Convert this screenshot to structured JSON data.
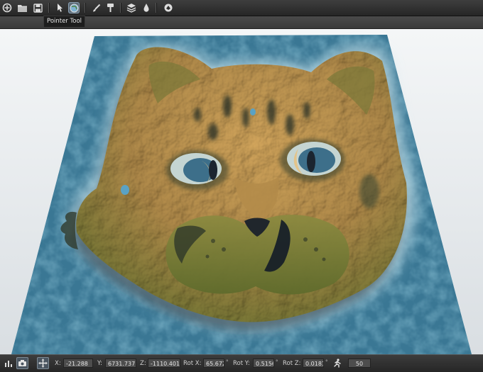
{
  "toolbar": {
    "tooltip": "Pointer Tool",
    "icons": [
      "new-scene-icon",
      "open-folder-icon",
      "save-icon",
      "pointer-tool-icon",
      "globe-icon",
      "paint-brush-icon",
      "flatten-tool-icon",
      "layers-icon",
      "water-drop-icon",
      "render-icon"
    ]
  },
  "statusbar": {
    "x_label": "X:",
    "x_value": "-21.288",
    "y_label": "Y:",
    "y_value": "6731.737",
    "z_label": "Z:",
    "z_value": "-1110.401",
    "rotx_label": "Rot X:",
    "rotx_value": "65.672",
    "roty_label": "Rot Y:",
    "roty_value": "0.5156",
    "rotz_label": "Rot Z:",
    "rotz_value": "0.0181",
    "degree_symbol": "°",
    "speed_value": "50"
  },
  "colors": {
    "toolbar_bg": "#2e2e2e",
    "water": "#3d7a96",
    "terrain_sand": "#c89a52",
    "terrain_green": "#6f7a32",
    "shadow": "#1e2a36"
  }
}
